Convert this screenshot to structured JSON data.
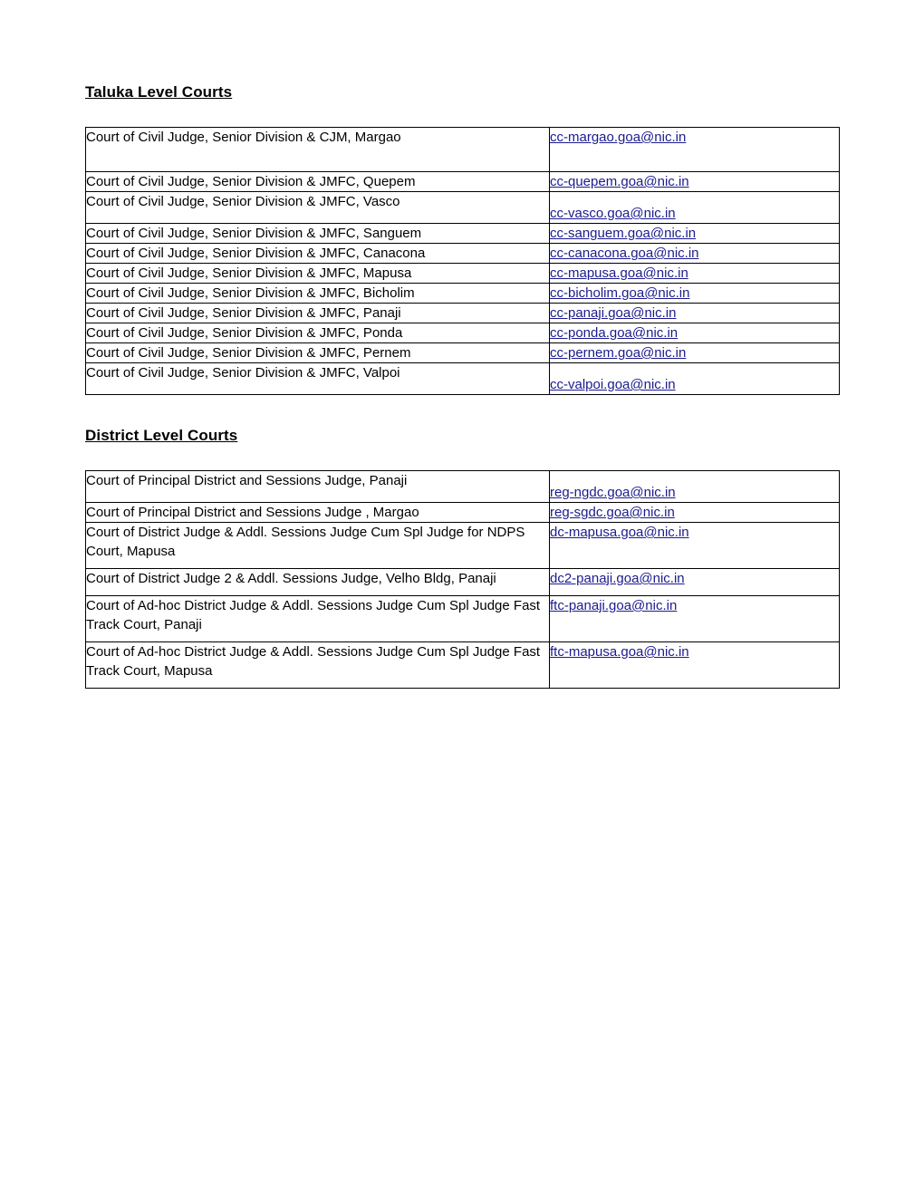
{
  "document": {
    "sections": [
      {
        "heading": "Taluka Level Courts",
        "rows": [
          {
            "court": "Court of Civil Judge, Senior Division & CJM, Margao",
            "email": "cc-margao.goa@nic.in"
          },
          {
            "court": "Court of Civil Judge, Senior Division & JMFC, Quepem",
            "email": "cc-quepem.goa@nic.in"
          },
          {
            "court": "Court of Civil Judge, Senior Division & JMFC, Vasco",
            "email": "cc-vasco.goa@nic.in"
          },
          {
            "court": "Court of Civil Judge, Senior Division & JMFC, Sanguem",
            "email": "cc-sanguem.goa@nic.in"
          },
          {
            "court": "Court of Civil Judge, Senior Division & JMFC, Canacona",
            "email": "cc-canacona.goa@nic.in"
          },
          {
            "court": "Court of Civil Judge, Senior Division & JMFC, Mapusa",
            "email": "cc-mapusa.goa@nic.in"
          },
          {
            "court": "Court of Civil Judge, Senior Division & JMFC, Bicholim",
            "email": "cc-bicholim.goa@nic.in"
          },
          {
            "court": "Court of Civil Judge, Senior Division & JMFC, Panaji",
            "email": "cc-panaji.goa@nic.in"
          },
          {
            "court": "Court of Civil Judge, Senior Division & JMFC, Ponda",
            "email": "cc-ponda.goa@nic.in"
          },
          {
            "court": "Court of Civil Judge, Senior Division & JMFC, Pernem",
            "email": "cc-pernem.goa@nic.in"
          },
          {
            "court": "Court of Civil Judge, Senior Division & JMFC, Valpoi",
            "email": "cc-valpoi.goa@nic.in"
          }
        ]
      },
      {
        "heading": "District Level Courts",
        "rows": [
          {
            "court": "Court of Principal District and Sessions Judge, Panaji",
            "email": "reg-ngdc.goa@nic.in"
          },
          {
            "court": "Court of Principal District and Sessions Judge , Margao",
            "email": "reg-sgdc.goa@nic.in"
          },
          {
            "court": "Court of District Judge & Addl. Sessions Judge Cum Spl Judge for NDPS Court, Mapusa",
            "email": "dc-mapusa.goa@nic.in"
          },
          {
            "court": "Court of District Judge 2 & Addl. Sessions Judge, Velho Bldg, Panaji",
            "email": "dc2-panaji.goa@nic.in"
          },
          {
            "court": "Court of Ad-hoc District Judge & Addl. Sessions Judge Cum Spl Judge Fast Track Court, Panaji",
            "email": "ftc-panaji.goa@nic.in"
          },
          {
            "court": "Court of Ad-hoc District Judge & Addl. Sessions Judge Cum Spl Judge Fast Track Court, Mapusa",
            "email": "ftc-mapusa.goa@nic.in"
          }
        ]
      }
    ],
    "colors": {
      "link": "#1b1b8f",
      "text": "#000000",
      "border": "#000000",
      "background": "#ffffff"
    }
  }
}
